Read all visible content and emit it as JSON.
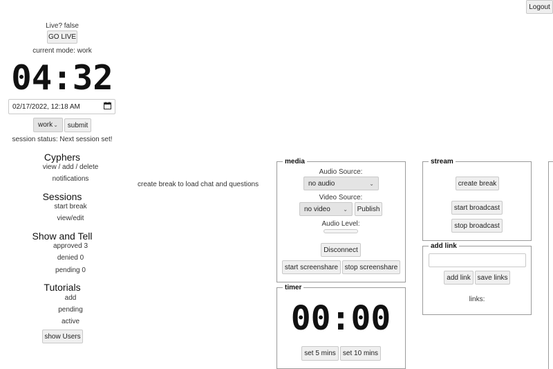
{
  "header": {
    "logout_label": "Logout"
  },
  "sidebar": {
    "live_status": "Live? false",
    "go_live_label": "GO LIVE",
    "current_mode": "current mode: work",
    "clock": "04:32",
    "datetime_value": "02/17/2022, 12:18 AM",
    "mode_select": {
      "selected": "work"
    },
    "submit_label": "submit",
    "session_status": "session status: Next session set!",
    "cyphers": {
      "title": "Cyphers",
      "view_add_delete": "view / add / delete",
      "notifications": "notifications"
    },
    "sessions": {
      "title": "Sessions",
      "start_break": "start break",
      "view_edit": "view/edit"
    },
    "show_and_tell": {
      "title": "Show and Tell",
      "approved": "approved 3",
      "denied": "denied 0",
      "pending": "pending 0"
    },
    "tutorials": {
      "title": "Tutorials",
      "add": "add",
      "pending": "pending",
      "active": "active"
    },
    "show_users_label": "show Users"
  },
  "center": {
    "message": "create break to load chat and questions"
  },
  "media": {
    "legend": "media",
    "audio_source_label": "Audio Source:",
    "audio_source_selected": "no audio",
    "video_source_label": "Video Source:",
    "video_source_selected": "no video",
    "publish_label": "Publish",
    "audio_level_label": "Audio Level:",
    "disconnect_label": "Disconnect",
    "start_screenshare_label": "start screenshare",
    "stop_screenshare_label": "stop screenshare"
  },
  "timer": {
    "legend": "timer",
    "display": "00:00",
    "set5_label": "set 5 mins",
    "set10_label": "set 10 mins"
  },
  "stream": {
    "legend": "stream",
    "create_break_label": "create break",
    "start_broadcast_label": "start broadcast",
    "stop_broadcast_label": "stop broadcast"
  },
  "add_link": {
    "legend": "add link",
    "input_value": "",
    "add_link_label": "add link",
    "save_links_label": "save links",
    "links_label": "links:"
  }
}
